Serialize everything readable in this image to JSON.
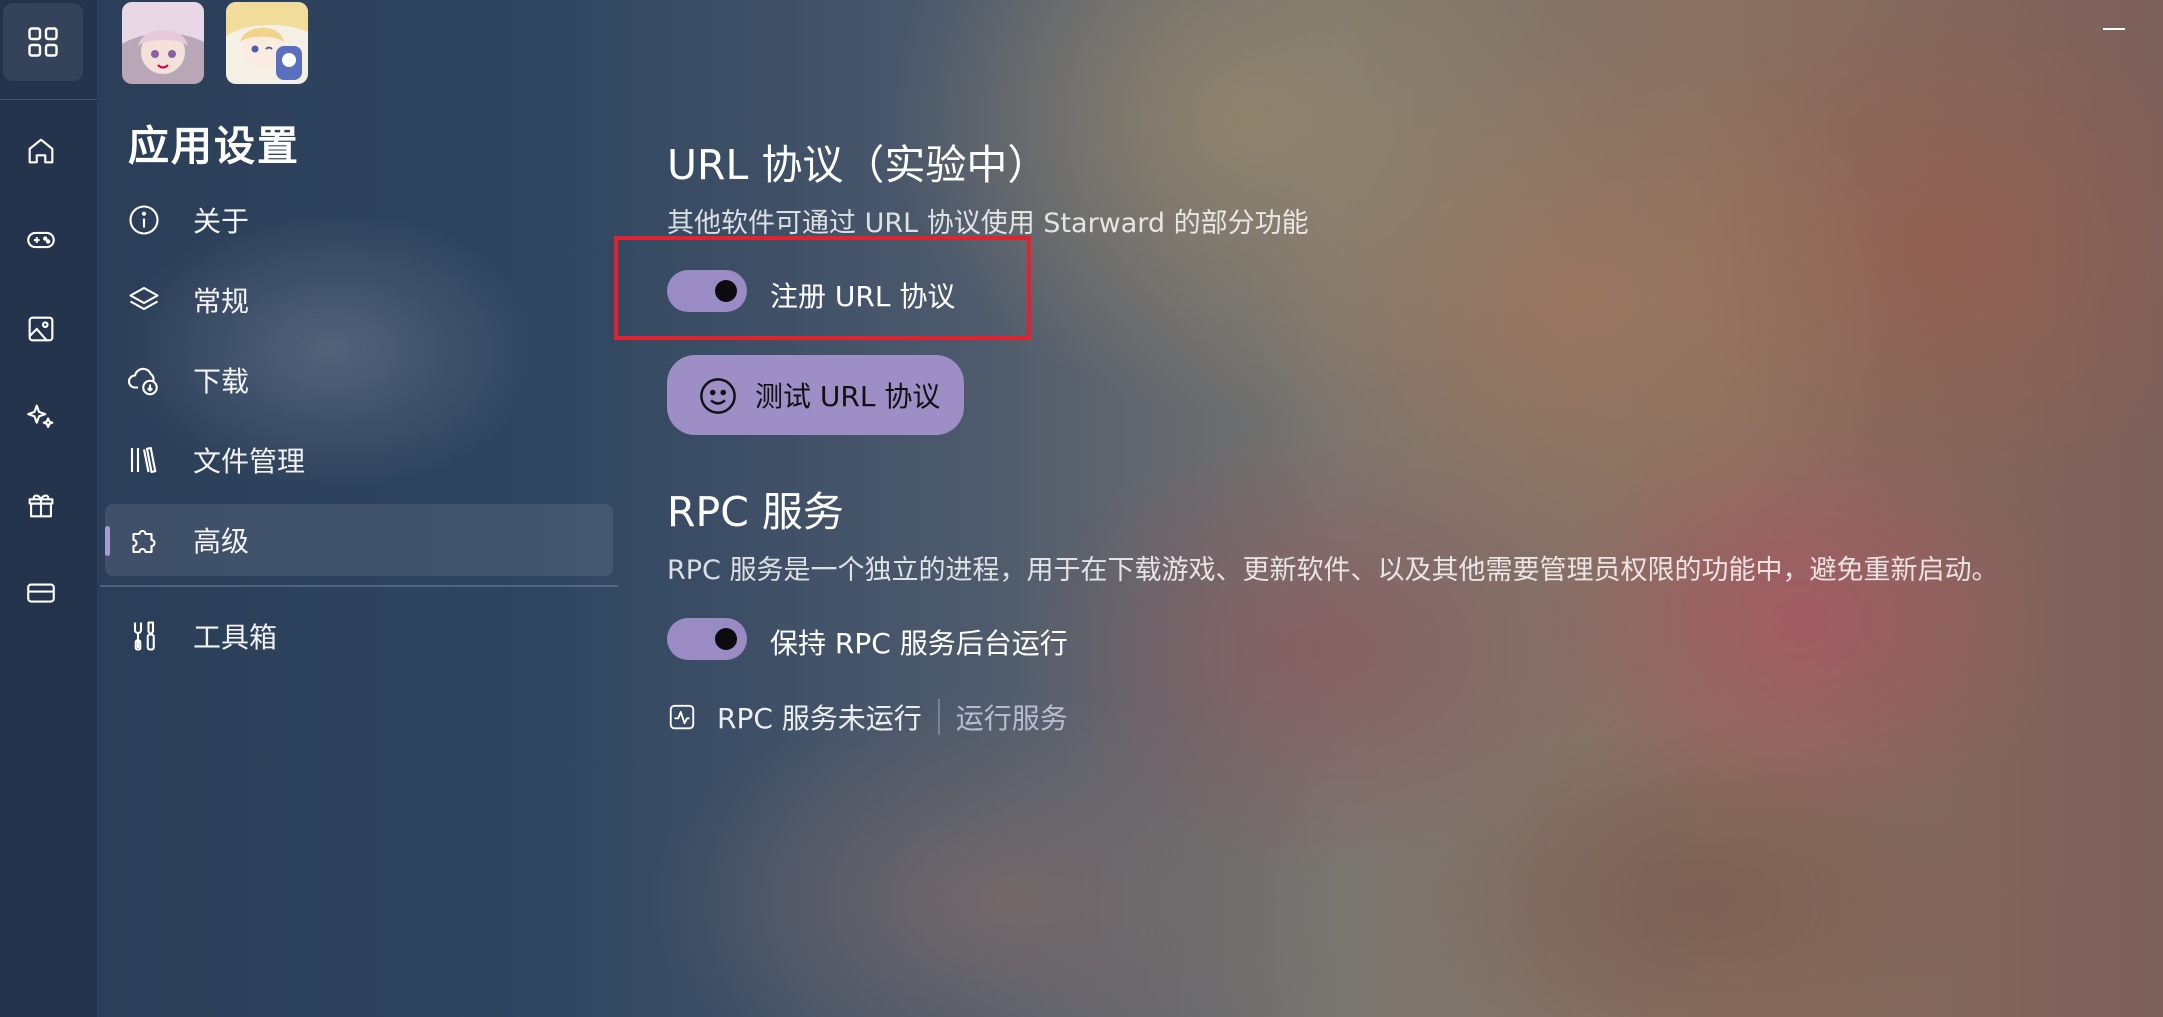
{
  "sidebar": {
    "icons": [
      "apps-grid-icon",
      "home-icon",
      "gamepad-icon",
      "image-icon",
      "sparkle-icon",
      "gift-icon",
      "card-icon"
    ]
  },
  "header": {
    "avatars": [
      "game-avatar-1",
      "game-avatar-2"
    ]
  },
  "settings": {
    "title": "应用设置",
    "nav": [
      {
        "label": "关于",
        "icon": "info-icon"
      },
      {
        "label": "常规",
        "icon": "layers-icon"
      },
      {
        "label": "下载",
        "icon": "cloud-download-icon"
      },
      {
        "label": "文件管理",
        "icon": "library-icon"
      },
      {
        "label": "高级",
        "icon": "puzzle-icon",
        "selected": true
      },
      {
        "label": "工具箱",
        "icon": "toolbox-icon"
      }
    ]
  },
  "url_protocol": {
    "title": "URL 协议（实验中）",
    "description": "其他软件可通过 URL 协议使用 Starward 的部分功能",
    "toggle_label": "注册 URL 协议",
    "toggle_on": true,
    "test_button": "测试 URL 协议"
  },
  "rpc": {
    "title": "RPC 服务",
    "description": "RPC 服务是一个独立的进程，用于在下载游戏、更新软件、以及其他需要管理员权限的功能中，避免重新启动。",
    "toggle_label": "保持 RPC 服务后台运行",
    "toggle_on": true,
    "status": "RPC 服务未运行",
    "run_link": "运行服务"
  },
  "colors": {
    "accent": "#9d8ec5",
    "highlight": "#e0232e"
  }
}
